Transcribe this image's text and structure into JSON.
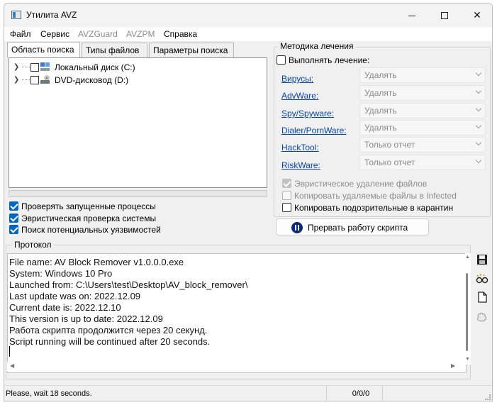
{
  "window": {
    "title": "Утилита AVZ"
  },
  "menu": [
    "Файл",
    "Сервис",
    "AVZGuard",
    "AVZPM",
    "Справка"
  ],
  "tabs": [
    "Область поиска",
    "Типы файлов",
    "Параметры поиска"
  ],
  "tree": [
    {
      "label": "Локальный диск (C:)",
      "icon": "hard-drive-icon",
      "checked": false
    },
    {
      "label": "DVD-дисковод (D:)",
      "icon": "dvd-drive-icon",
      "checked": false
    }
  ],
  "options": [
    {
      "label": "Проверять запущенные процессы",
      "checked": true
    },
    {
      "label": "Эвристическая проверка системы",
      "checked": true
    },
    {
      "label": "Поиск потенциальных уязвимостей",
      "checked": true
    }
  ],
  "treatment": {
    "title": "Методика лечения",
    "perform_label": "Выполнять лечение:",
    "perform_checked": false,
    "rows": [
      {
        "label": "Вирусы:",
        "value": "Удалять"
      },
      {
        "label": "AdvWare:",
        "value": "Удалять"
      },
      {
        "label": "Spy/Spyware:",
        "value": "Удалять"
      },
      {
        "label": "Dialer/PornWare:",
        "value": "Удалять"
      },
      {
        "label": "HackTool:",
        "value": "Только отчет"
      },
      {
        "label": "RiskWare:",
        "value": "Только отчет"
      }
    ],
    "heuristic_delete": "Эвристическое удаление файлов",
    "copy_deleted": "Копировать удаляемые файлы в  Infected",
    "copy_suspicious": "Копировать подозрительные в  карантин"
  },
  "stop_button": "Прервать работу скрипта",
  "protocol": {
    "title": "Протокол",
    "lines": [
      "File name: AV Block Remover v1.0.0.0.exe",
      "System: Windows 10 Pro",
      "Launched from: C:\\Users\\test\\Desktop\\AV_block_remover\\",
      "Last update was on: 2022.12.09",
      "Current date is: 2022.12.10",
      "This version is up to date: 2022.12.09",
      "Работа скрипта продолжится через 20 секунд.",
      "Script running will be continued after 20 seconds."
    ]
  },
  "side_tools": [
    "save-icon",
    "glasses-icon",
    "document-icon",
    "brain-icon"
  ],
  "status": {
    "left": "Please, wait 18 seconds.",
    "right": "0/0/0"
  },
  "colors": {
    "accent": "#0067c0",
    "link": "#0645ad",
    "stop_icon": "#0b2b78"
  }
}
